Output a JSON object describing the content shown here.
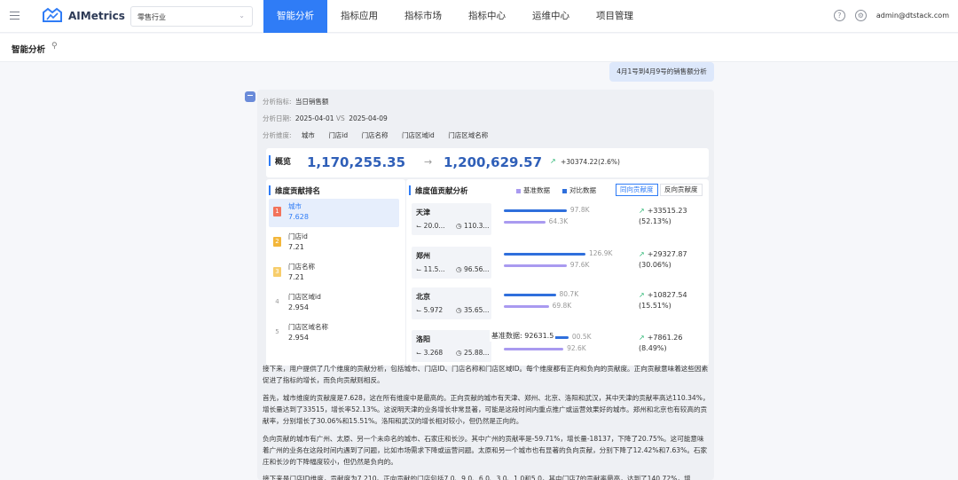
{
  "header": {
    "brand": "AIMetrics",
    "industry_select": "零售行业",
    "nav": [
      "智能分析",
      "指标应用",
      "指标市场",
      "指标中心",
      "运维中心",
      "项目管理"
    ],
    "active_nav": 0,
    "user": "admin@dtstack.com"
  },
  "breadcrumb": {
    "title": "智能分析"
  },
  "question": "4月1号到4月9号的销售额分析",
  "analysis": {
    "metric_label": "分析指标:",
    "metric_value": "当日销售额",
    "date_label": "分析日期:",
    "date_from": "2025-04-01",
    "vs": "VS",
    "date_to": "2025-04-09",
    "dim_label": "分析维度:",
    "dimensions": [
      "城市",
      "门店id",
      "门店名称",
      "门店区域id",
      "门店区域名称"
    ]
  },
  "overview": {
    "label": "概览",
    "base_value": "1,170,255.35",
    "compare_value": "1,200,629.57",
    "delta": "+30374.22(2.6%)"
  },
  "ranking": {
    "title": "维度贡献排名",
    "items": [
      {
        "rank": "1",
        "name": "城市",
        "value": "7.628"
      },
      {
        "rank": "2",
        "name": "门店id",
        "value": "7.21"
      },
      {
        "rank": "3",
        "name": "门店名称",
        "value": "7.21"
      },
      {
        "rank": "4",
        "name": "门店区域id",
        "value": "2.954"
      },
      {
        "rank": "5",
        "name": "门店区域名称",
        "value": "2.954"
      }
    ]
  },
  "contribution": {
    "title": "维度值贡献分析",
    "legend_base": "基准数据",
    "legend_compare": "对比数据",
    "toggle_positive": "同向贡献度",
    "toggle_negative": "反向贡献度",
    "tooltip": "基准数据:  92631.5",
    "rows": [
      {
        "city": "天津",
        "m1": "20.0...",
        "m2": "110.3...",
        "compare": 97.8,
        "base": 64.3,
        "compare_label": "97.8K",
        "base_label": "64.3K",
        "delta": "+33515.23",
        "pct": "(52.13%)"
      },
      {
        "city": "郑州",
        "m1": "11.5...",
        "m2": "96.56...",
        "compare": 126.9,
        "base": 97.6,
        "compare_label": "126.9K",
        "base_label": "97.6K",
        "delta": "+29327.87",
        "pct": "(30.06%)"
      },
      {
        "city": "北京",
        "m1": "5.972",
        "m2": "35.65...",
        "compare": 80.7,
        "base": 69.8,
        "compare_label": "80.7K",
        "base_label": "69.8K",
        "delta": "+10827.54",
        "pct": "(15.51%)"
      },
      {
        "city": "洛阳",
        "m1": "3.268",
        "m2": "25.88...",
        "compare": 100.5,
        "base": 92.6,
        "compare_label": "00.5K",
        "base_label": "92.6K",
        "delta": "+7861.26",
        "pct": "(8.49%)"
      }
    ]
  },
  "paragraphs": [
    "接下来，用户提供了几个维度的贡献分析，包括城市、门店ID、门店名称和门店区域ID。每个维度都有正向和负向的贡献度。正向贡献意味着这些因素促进了指标的增长，而负向贡献则相反。",
    "首先，城市维度的贡献度是7.628，这在所有维度中是最高的。正向贡献的城市有天津、郑州、北京、洛阳和武汉，其中天津的贡献率高达110.34%，增长量达到了33515，增长率52.13%。这说明天津的业务增长非常显著，可能是这段时间内重点推广或运营效果好的城市。郑州和北京也有较高的贡献率，分别增长了30.06%和15.51%。洛阳和武汉的增长相对较小，但仍然是正向的。",
    "负向贡献的城市有广州、太原、另一个未命名的城市、石家庄和长沙。其中广州的贡献率是-59.71%，增长量-18137，下降了20.75%。这可能意味着广州的业务在这段时间内遇到了问题，比如市场需求下降或运营问题。太原和另一个城市也有显著的负向贡献，分别下降了12.42%和7.63%。石家庄和长沙的下降幅度较小，但仍然是负向的。",
    "接下来是门店ID维度，贡献度为7.210。正向贡献的门店包括7.0、9.0、6.0、3.0、1.0和5.0，其中门店7的贡献率最高，达到了140.72%，增"
  ]
}
